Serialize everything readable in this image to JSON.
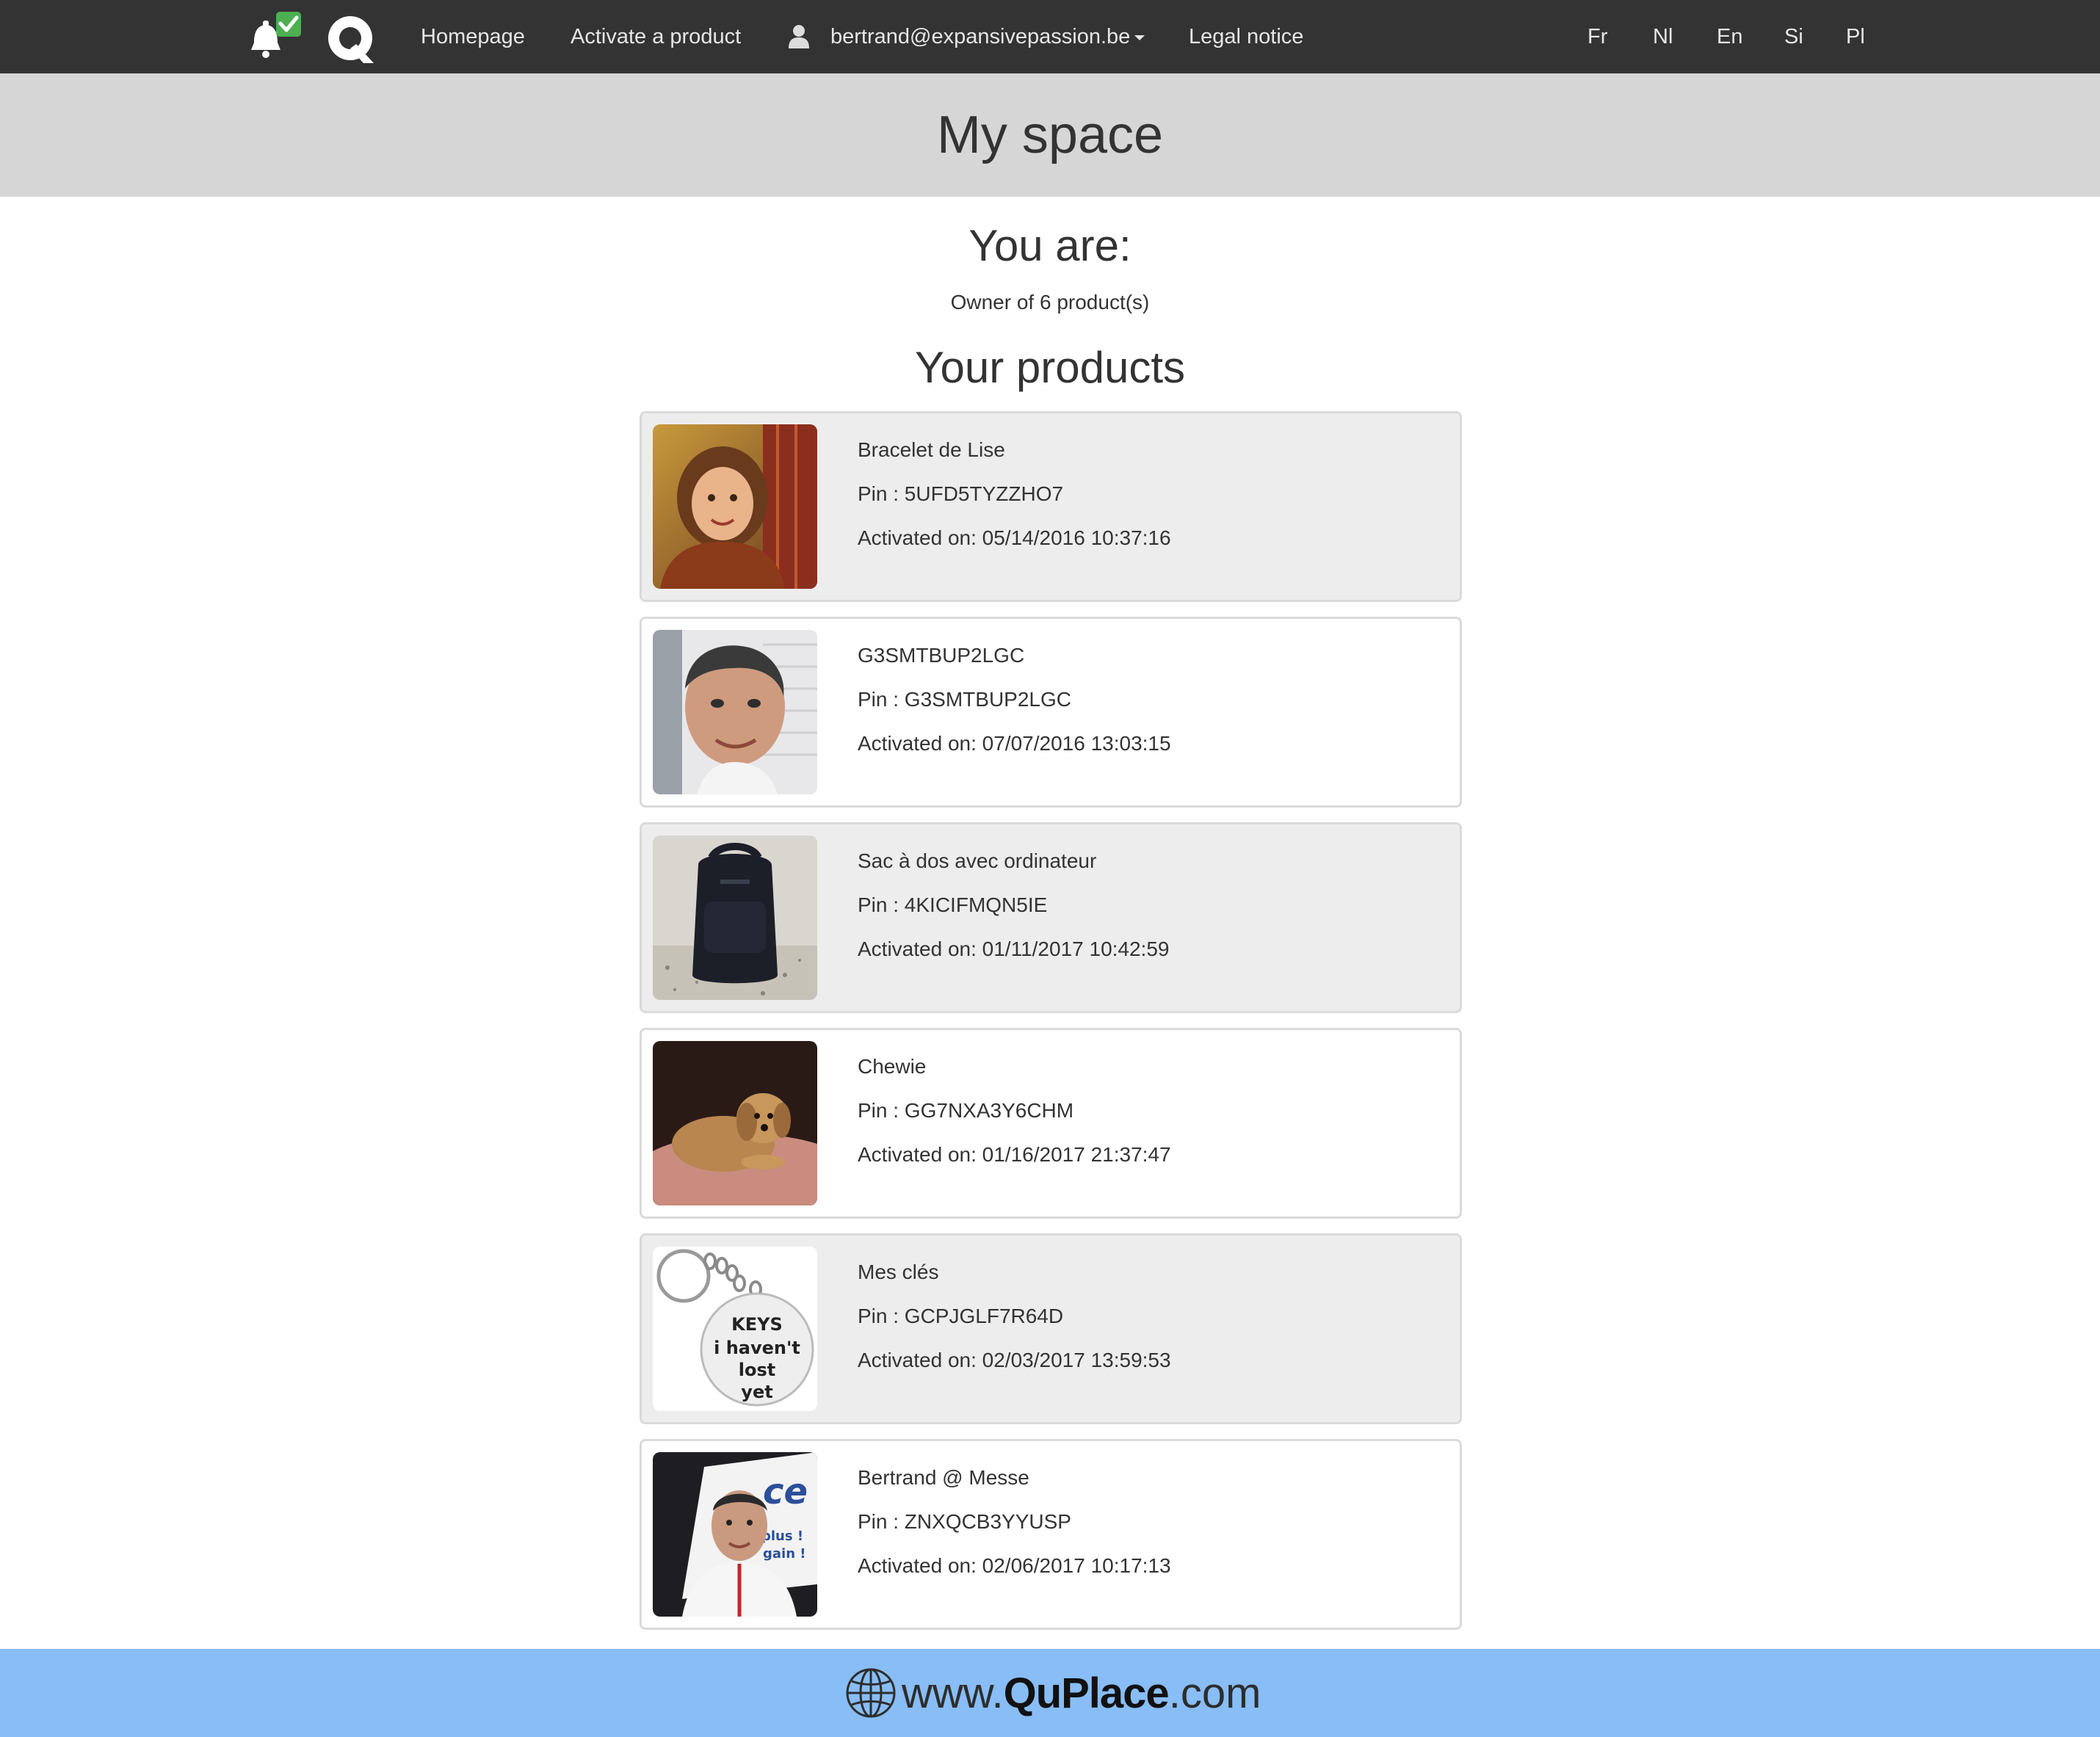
{
  "nav": {
    "homepage": "Homepage",
    "activate": "Activate a product",
    "user_email": "bertrand@expansivepassion.be",
    "legal": "Legal notice",
    "languages": [
      "Fr",
      "Nl",
      "En",
      "Si",
      "Pl"
    ]
  },
  "header": {
    "title": "My space"
  },
  "profile": {
    "you_are": "You are:",
    "owner_text": "Owner of 6 product(s)",
    "products_title": "Your products"
  },
  "products": [
    {
      "name": "Bracelet de Lise",
      "pin": "Pin : 5UFD5TYZZHO7",
      "activated": "Activated on: 05/14/2016 10:37:16",
      "image": "girl-portrait-photo"
    },
    {
      "name": "G3SMTBUP2LGC",
      "pin": "Pin : G3SMTBUP2LGC",
      "activated": "Activated on: 07/07/2016 13:03:15",
      "image": "man-portrait-photo"
    },
    {
      "name": "Sac à dos avec ordinateur",
      "pin": "Pin : 4KICIFMQN5IE",
      "activated": "Activated on: 01/11/2017 10:42:59",
      "image": "backpack-photo"
    },
    {
      "name": "Chewie",
      "pin": "Pin : GG7NXA3Y6CHM",
      "activated": "Activated on: 01/16/2017 21:37:47",
      "image": "dog-photo"
    },
    {
      "name": "Mes clés",
      "pin": "Pin : GCPJGLF7R64D",
      "activated": "Activated on: 02/03/2017 13:59:53",
      "image": "keychain-photo"
    },
    {
      "name": "Bertrand @ Messe",
      "pin": "Pin : ZNXQCB3YYUSP",
      "activated": "Activated on: 02/06/2017 10:17:13",
      "image": "man-at-fair-photo"
    }
  ],
  "keychain_text": [
    "KEYS",
    "i haven't",
    "lost",
    "yet"
  ],
  "fair_sign_text": [
    "ce",
    "plus !",
    "gain !"
  ],
  "footer": {
    "prefix": "www.",
    "brand": "QuPlace",
    "suffix": ".com"
  },
  "colors": {
    "navbar": "#333333",
    "header_band": "#d6d6d6",
    "footer": "#88bdf5",
    "bell_check": "#4caf50"
  }
}
